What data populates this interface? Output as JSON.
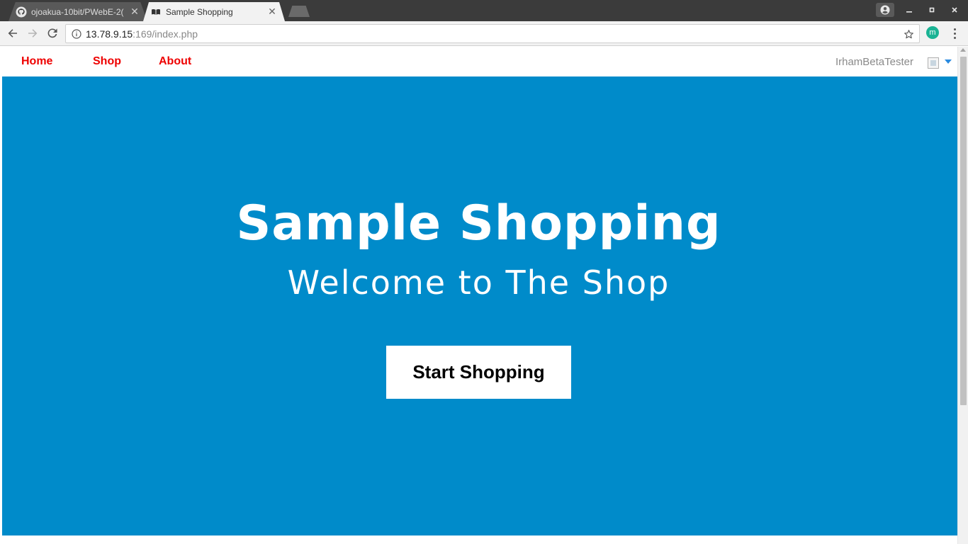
{
  "browser": {
    "tabs": [
      {
        "title": "ojoakua-10bit/PWebE-2(",
        "active": false,
        "favicon": "github-icon"
      },
      {
        "title": "Sample Shopping",
        "active": true,
        "favicon": "book-icon"
      }
    ],
    "tab_close_glyph": "✕",
    "url_host": "13.78.9.15",
    "url_path": ":169/index.php",
    "extension_label": "m",
    "colors": {
      "tabstrip": "#3b3b3b",
      "toolbar": "#f2f2f2",
      "extension": "#1ab394"
    }
  },
  "site": {
    "nav": {
      "links": [
        "Home",
        "Shop",
        "About"
      ],
      "user": "IrhamBetaTester",
      "link_color": "#ee0000"
    },
    "hero": {
      "title": "Sample Shopping",
      "subtitle": "Welcome to The Shop",
      "button": "Start Shopping",
      "background": "#008bca"
    }
  }
}
